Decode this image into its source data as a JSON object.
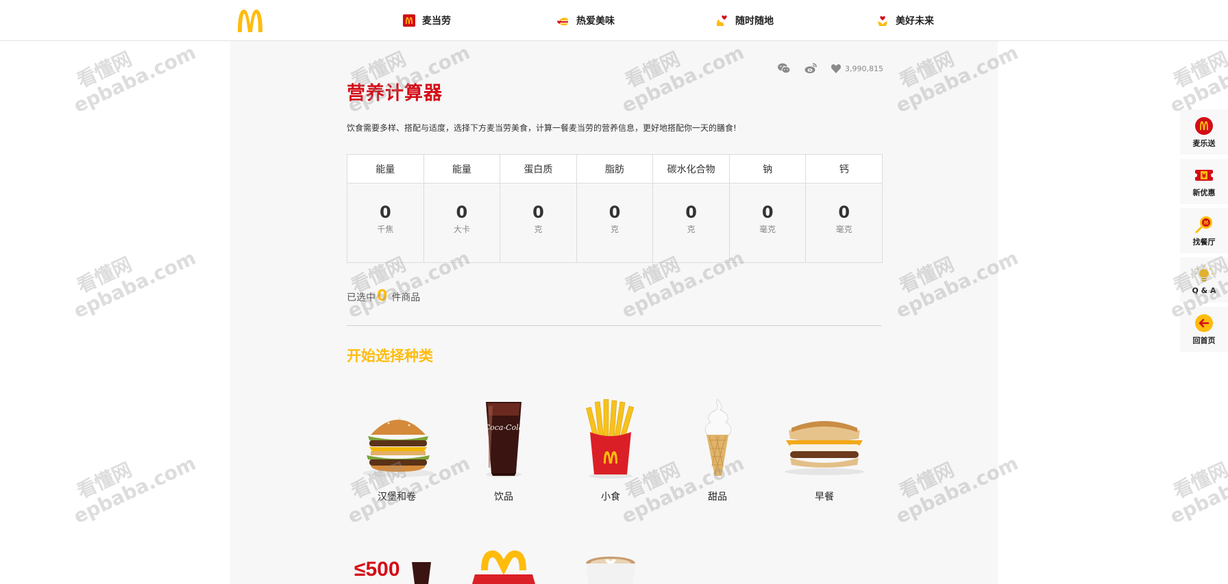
{
  "nav": {
    "items": [
      {
        "label": "麦当劳",
        "icon": "mcd-box-icon"
      },
      {
        "label": "热爱美味",
        "icon": "burger-heart-icon"
      },
      {
        "label": "随时随地",
        "icon": "hand-heart-icon"
      },
      {
        "label": "美好未来",
        "icon": "heart-hands-icon"
      }
    ]
  },
  "share": {
    "likes": "3,990,815"
  },
  "page": {
    "title": "营养计算器",
    "intro": "饮食需要多样、搭配与适度，选择下方麦当劳美食，计算一餐麦当劳的营养信息，更好地搭配你一天的膳食!"
  },
  "nutrition": [
    {
      "name": "能量",
      "value": "0",
      "unit": "千焦"
    },
    {
      "name": "能量",
      "value": "0",
      "unit": "大卡"
    },
    {
      "name": "蛋白质",
      "value": "0",
      "unit": "克"
    },
    {
      "name": "脂肪",
      "value": "0",
      "unit": "克"
    },
    {
      "name": "碳水化合物",
      "value": "0",
      "unit": "克"
    },
    {
      "name": "钠",
      "value": "0",
      "unit": "毫克"
    },
    {
      "name": "钙",
      "value": "0",
      "unit": "毫克"
    }
  ],
  "selected": {
    "prefix": "已选中",
    "count": "0",
    "suffix": "件商品"
  },
  "section_title": "开始选择种类",
  "categories": [
    {
      "label": "汉堡和卷"
    },
    {
      "label": "饮品"
    },
    {
      "label": "小食"
    },
    {
      "label": "甜品"
    },
    {
      "label": "早餐"
    }
  ],
  "promo_text": "≤500",
  "sidetools": [
    {
      "label": "麦乐送"
    },
    {
      "label": "新优惠"
    },
    {
      "label": "找餐厅"
    },
    {
      "label": "Q & A"
    },
    {
      "label": "回首页"
    }
  ],
  "watermark": {
    "cn": "看懂网",
    "en": "epbaba.com"
  },
  "colors": {
    "brand_red": "#d30d17",
    "brand_yellow": "#ffbc0d",
    "panel": "#f7f7f7"
  }
}
